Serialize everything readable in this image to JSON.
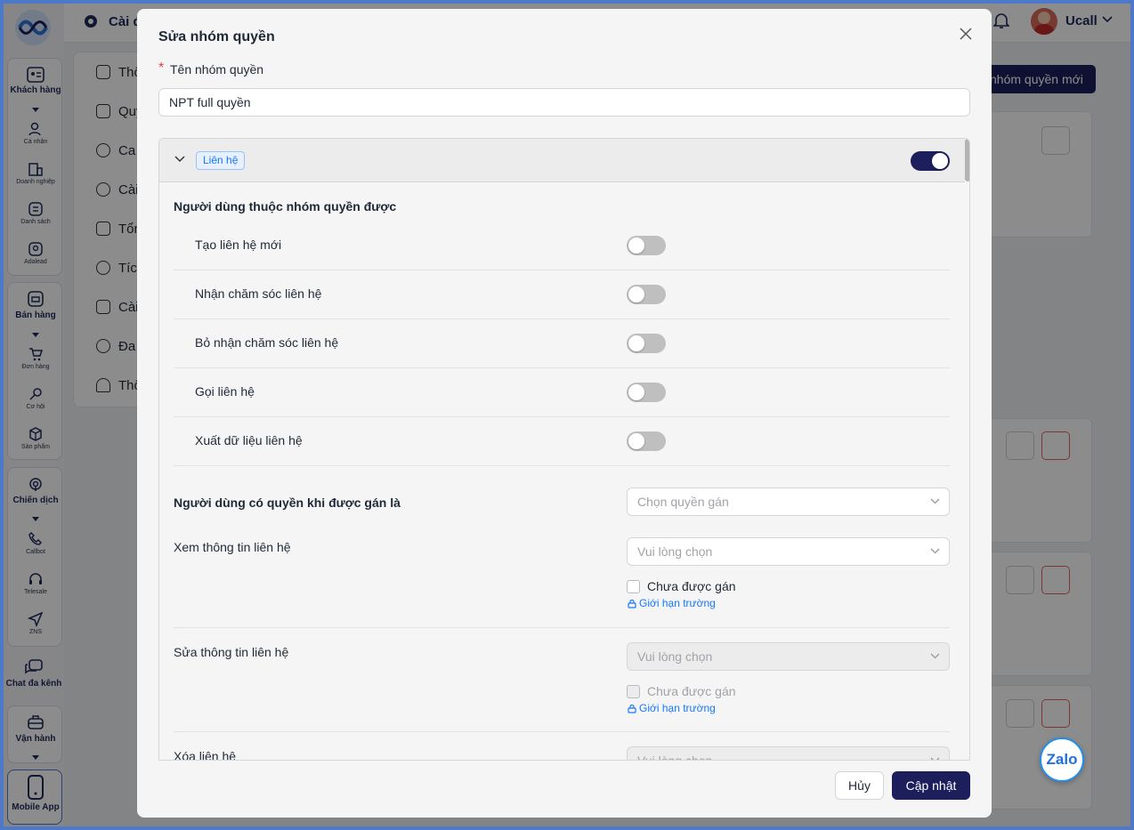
{
  "app": {
    "page_title": "Cài đ",
    "user_name": "Ucall"
  },
  "sidebar": {
    "groups": [
      {
        "label": "Khách hàng",
        "items": [
          "Cá nhân",
          "Doanh nghiệp",
          "Danh sách",
          "Adalead"
        ]
      },
      {
        "label": "Bán hàng",
        "items": [
          "Đơn hàng",
          "Cơ hội",
          "Sản phẩm"
        ]
      },
      {
        "label": "Chiến dịch",
        "items": [
          "Callbot",
          "Telesale",
          "ZNS"
        ]
      },
      {
        "label": "Chat đa kênh",
        "items": []
      },
      {
        "label": "Vận hành",
        "items": []
      },
      {
        "label": "Mobile App",
        "items": []
      }
    ]
  },
  "settings_menu": [
    "Thô",
    "Quy",
    "Ca",
    "Cài",
    "Tổn",
    "Tích",
    "Cài",
    "Đa",
    "Thô"
  ],
  "background": {
    "new_group_button": "nhóm quyền mới",
    "zalo": "Zalo"
  },
  "modal": {
    "title": "Sửa nhóm quyền",
    "name_label": "Tên nhóm quyền",
    "required_mark": "*",
    "name_value": "NPT full quyền",
    "section_tag": "Liên hệ",
    "section_enabled": true,
    "group_heading": "Người dùng thuộc nhóm quyền được",
    "permissions": [
      {
        "label": "Tạo liên hệ mới",
        "enabled": false
      },
      {
        "label": "Nhận chăm sóc liên hệ",
        "enabled": false
      },
      {
        "label": "Bỏ nhận chăm sóc liên hệ",
        "enabled": false
      },
      {
        "label": "Gọi liên hệ",
        "enabled": false
      },
      {
        "label": "Xuất dữ liệu liên hệ",
        "enabled": false
      }
    ],
    "assigned_heading": "Người dùng có quyền khi được gán là",
    "assigned_placeholder": "Chọn quyền gán",
    "rows": [
      {
        "label": "Xem thông tin liên hệ",
        "placeholder": "Vui lòng chọn",
        "checkbox": "Chưa được gán",
        "link": "Giới hạn trường",
        "disabled": false
      },
      {
        "label": "Sửa thông tin liên hệ",
        "placeholder": "Vui lòng chọn",
        "checkbox": "Chưa được gán",
        "link": "Giới hạn trường",
        "disabled": true
      },
      {
        "label": "Xóa liên hệ",
        "placeholder": "Vui lòng chọn",
        "disabled": true
      }
    ],
    "cancel_label": "Hủy",
    "submit_label": "Cập nhật"
  },
  "colors": {
    "primary": "#1c1f5c",
    "tag": "#1677ff",
    "danger": "#e24444"
  }
}
